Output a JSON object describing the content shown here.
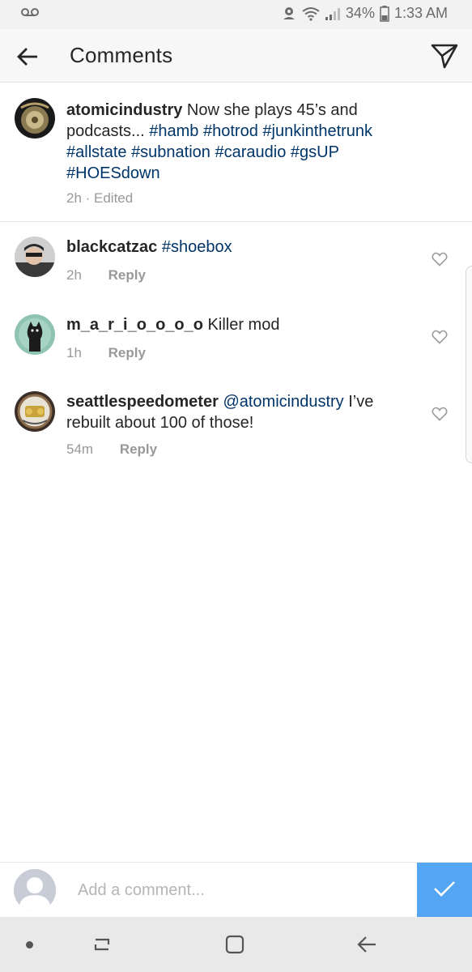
{
  "status_bar": {
    "battery_percent": "34%",
    "time": "1:33 AM",
    "icons": [
      "voicemail-icon",
      "data-saver-icon",
      "wifi-icon",
      "signal-icon",
      "battery-icon"
    ]
  },
  "header": {
    "title": "Comments",
    "back_icon": "arrow-left-icon",
    "send_icon": "paper-plane-icon"
  },
  "caption": {
    "username": "atomicindustry",
    "text": "Now she plays 45’s and podcasts...",
    "hashtags": [
      "#hamb",
      "#hotrod",
      "#junkinthetrunk",
      "#allstate",
      "#subnation",
      "#caraudio",
      "#gsUP",
      "#HOESdown"
    ],
    "meta": "2h · Edited"
  },
  "comments": [
    {
      "username": "blackcatzac",
      "mention": "",
      "text": "",
      "tag": "#shoebox",
      "time": "2h",
      "reply_label": "Reply"
    },
    {
      "username": "m_a_r_i_o_o_o_o",
      "mention": "",
      "text": "Killer mod",
      "tag": "",
      "time": "1h",
      "reply_label": "Reply"
    },
    {
      "username": "seattlespeedometer",
      "mention": "@atomicindustry",
      "text": "I’ve rebuilt about 100 of those!",
      "tag": "",
      "time": "54m",
      "reply_label": "Reply"
    }
  ],
  "comment_input": {
    "placeholder": "Add a comment...",
    "value": ""
  },
  "colors": {
    "hashtag": "#003569",
    "post_button": "#3897f0",
    "muted_text": "#999999"
  },
  "nav_bar": {
    "icons": [
      "recent-apps-icon",
      "home-icon",
      "back-icon"
    ]
  }
}
